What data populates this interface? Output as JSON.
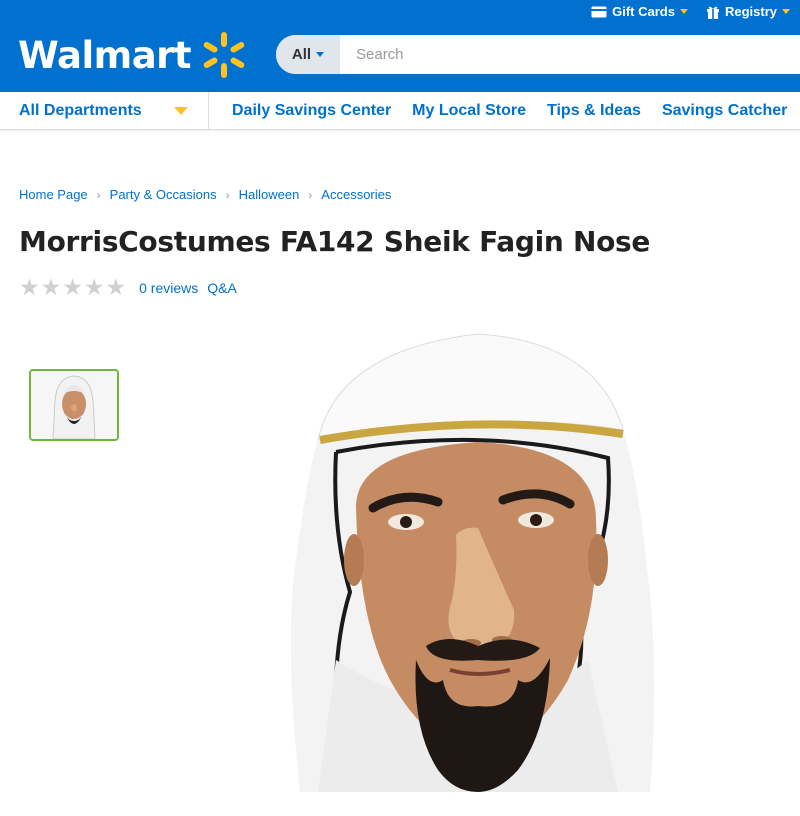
{
  "header": {
    "logo_text": "Walmart",
    "gift_cards": "Gift Cards",
    "registry": "Registry",
    "search": {
      "category": "All",
      "placeholder": "Search"
    },
    "brand_color": "#0071ce",
    "accent_color": "#ffc220"
  },
  "nav": {
    "departments": "All Departments",
    "links": [
      "Daily Savings Center",
      "My Local Store",
      "Tips & Ideas",
      "Savings Catcher"
    ]
  },
  "breadcrumb": [
    "Home Page",
    "Party & Occasions",
    "Halloween",
    "Accessories"
  ],
  "product": {
    "title": "MorrisCostumes FA142 Sheik Fagin Nose",
    "reviews": "0 reviews",
    "qa": "Q&A",
    "rating": 0,
    "max_rating": 5
  }
}
